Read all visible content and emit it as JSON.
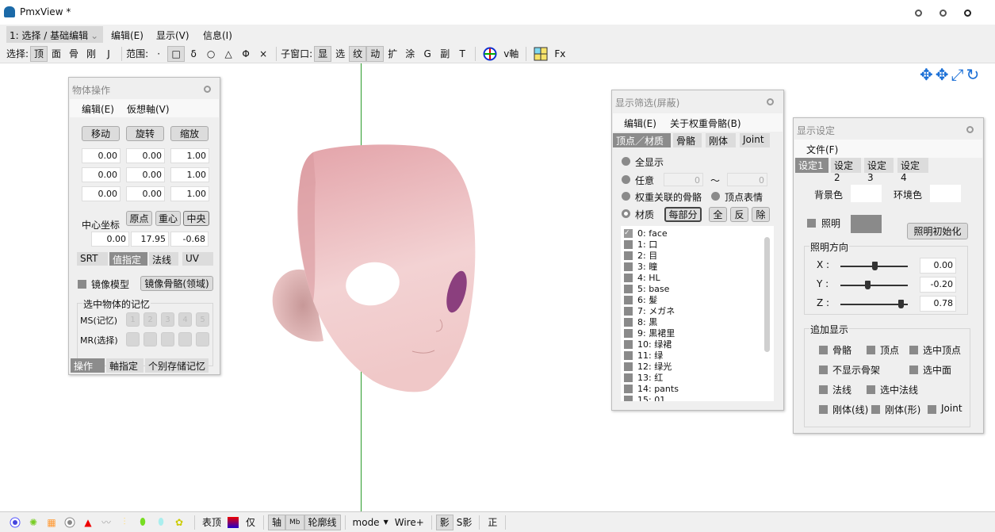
{
  "window": {
    "title": "PmxView *",
    "controls": [
      "minimize",
      "maximize",
      "close"
    ]
  },
  "menubar": {
    "mode": "1: 选择 / 基础编辑",
    "menus": [
      "编辑(E)",
      "显示(V)",
      "信息(I)"
    ]
  },
  "toolbar": {
    "select_label": "选择:",
    "select_items": [
      {
        "label": "顶",
        "on": true
      },
      {
        "label": "面"
      },
      {
        "label": "骨"
      },
      {
        "label": "刚"
      },
      {
        "label": "J"
      }
    ],
    "range_label": "范围:",
    "range_items": [
      {
        "label": "·"
      },
      {
        "label": "□",
        "on": true
      },
      {
        "label": "δ"
      },
      {
        "label": "○"
      },
      {
        "label": "△"
      },
      {
        "label": "Φ"
      },
      {
        "label": "×"
      }
    ],
    "sub_label": "子窗口:",
    "sub_items": [
      {
        "label": "显",
        "on": true
      },
      {
        "label": "选"
      },
      {
        "label": "纹",
        "on": true
      },
      {
        "label": "动",
        "on": true
      },
      {
        "label": "扩"
      },
      {
        "label": "涂"
      },
      {
        "label": "G"
      },
      {
        "label": "副"
      },
      {
        "label": "T"
      }
    ],
    "vaxis": "v軸",
    "fx": "Fx"
  },
  "object_panel": {
    "title": "物体操作",
    "menus": [
      "编辑(E)",
      "仮想軸(V)"
    ],
    "buttons": [
      "移动",
      "旋转",
      "缩放"
    ],
    "values": [
      [
        "0.00",
        "0.00",
        "1.00"
      ],
      [
        "0.00",
        "0.00",
        "1.00"
      ],
      [
        "0.00",
        "0.00",
        "1.00"
      ]
    ],
    "center_label": "中心坐标",
    "center_buttons": [
      "原点",
      "重心",
      "中央"
    ],
    "center_values": [
      "0.00",
      "17.95",
      "-0.68"
    ],
    "tabs": [
      {
        "label": "SRT"
      },
      {
        "label": "值指定",
        "on": true
      },
      {
        "label": "法线"
      },
      {
        "label": "UV"
      }
    ],
    "mirror_label": "镜像模型",
    "mirror_bone_button": "镜像骨骼(领域)",
    "memory_group": "选中物体的记忆",
    "ms_label": "MS(记忆)",
    "mr_label": "MR(选择)",
    "slots": [
      "1",
      "2",
      "3",
      "4",
      "5"
    ],
    "bottom_tabs": [
      {
        "label": "操作",
        "on": true
      },
      {
        "label": "軸指定"
      },
      {
        "label": "个别存储记忆"
      }
    ]
  },
  "filter_panel": {
    "title": "显示筛选(屏蔽)",
    "menus": [
      "编辑(E)",
      "关于权重骨骼(B)"
    ],
    "tabs": [
      {
        "label": "顶点／材质",
        "on": true
      },
      {
        "label": "骨骼"
      },
      {
        "label": "刚体"
      },
      {
        "label": "Joint"
      }
    ],
    "all": "全显示",
    "any": "任意",
    "any_from": "0",
    "tilde": "〜",
    "any_to": "0",
    "weight_bones": "权重关联的骨骼",
    "vertex_morph": "顶点表情",
    "material": "材质",
    "per_part": "每部分",
    "btn_all": "全",
    "btn_invert": "反",
    "btn_remove": "除",
    "materials": [
      {
        "label": "0: face",
        "checked": true
      },
      {
        "label": "1: 口"
      },
      {
        "label": "2: 目"
      },
      {
        "label": "3: 瞳"
      },
      {
        "label": "4: HL"
      },
      {
        "label": "5: base"
      },
      {
        "label": "6: 髮"
      },
      {
        "label": "7: メガネ"
      },
      {
        "label": "8: 黒"
      },
      {
        "label": "9: 黒裙里"
      },
      {
        "label": "10: 绿裙"
      },
      {
        "label": "11: 绿"
      },
      {
        "label": "12: 绿光"
      },
      {
        "label": "13: 红"
      },
      {
        "label": "14: pants"
      },
      {
        "label": "15: 01"
      }
    ]
  },
  "display_panel": {
    "title": "显示设定",
    "menus": [
      "文件(F)"
    ],
    "tabs": [
      {
        "label": "设定1",
        "on": true
      },
      {
        "label": "设定2"
      },
      {
        "label": "设定3"
      },
      {
        "label": "设定4"
      }
    ],
    "bg_color_label": "背景色",
    "ambient_label": "环境色",
    "light_label": "照明",
    "light_reset": "照明初始化",
    "colors": {
      "background": "#ffffff",
      "ambient": "#ffffff",
      "light": "#8a8a8a"
    },
    "light_dir_group": "照明方向",
    "light_dir": [
      {
        "axis": "X :",
        "value": "0.00",
        "num": 0.0
      },
      {
        "axis": "Y :",
        "value": "-0.20",
        "num": -0.2
      },
      {
        "axis": "Z :",
        "value": "0.78",
        "num": 0.78
      }
    ],
    "extra_group": "追加显示",
    "extras": [
      "骨骼",
      "顶点",
      "选中顶点",
      "不显示骨架",
      "选中面",
      "法线",
      "选中法线",
      "刚体(线)",
      "刚体(形)",
      "Joint"
    ]
  },
  "bottombar": {
    "surface_vertex": "表顶",
    "only": "仅",
    "axis": "轴",
    "mb": "Mb",
    "outline": "轮廓线",
    "mode": "mode",
    "wire": "Wire+",
    "shadow": "影",
    "sshadow": "S影",
    "front": "正"
  },
  "colors": {
    "accent_tab": "#8c8c8c",
    "axis_line": "#2a9a2a",
    "nav_icons": "#1a6fd6"
  }
}
